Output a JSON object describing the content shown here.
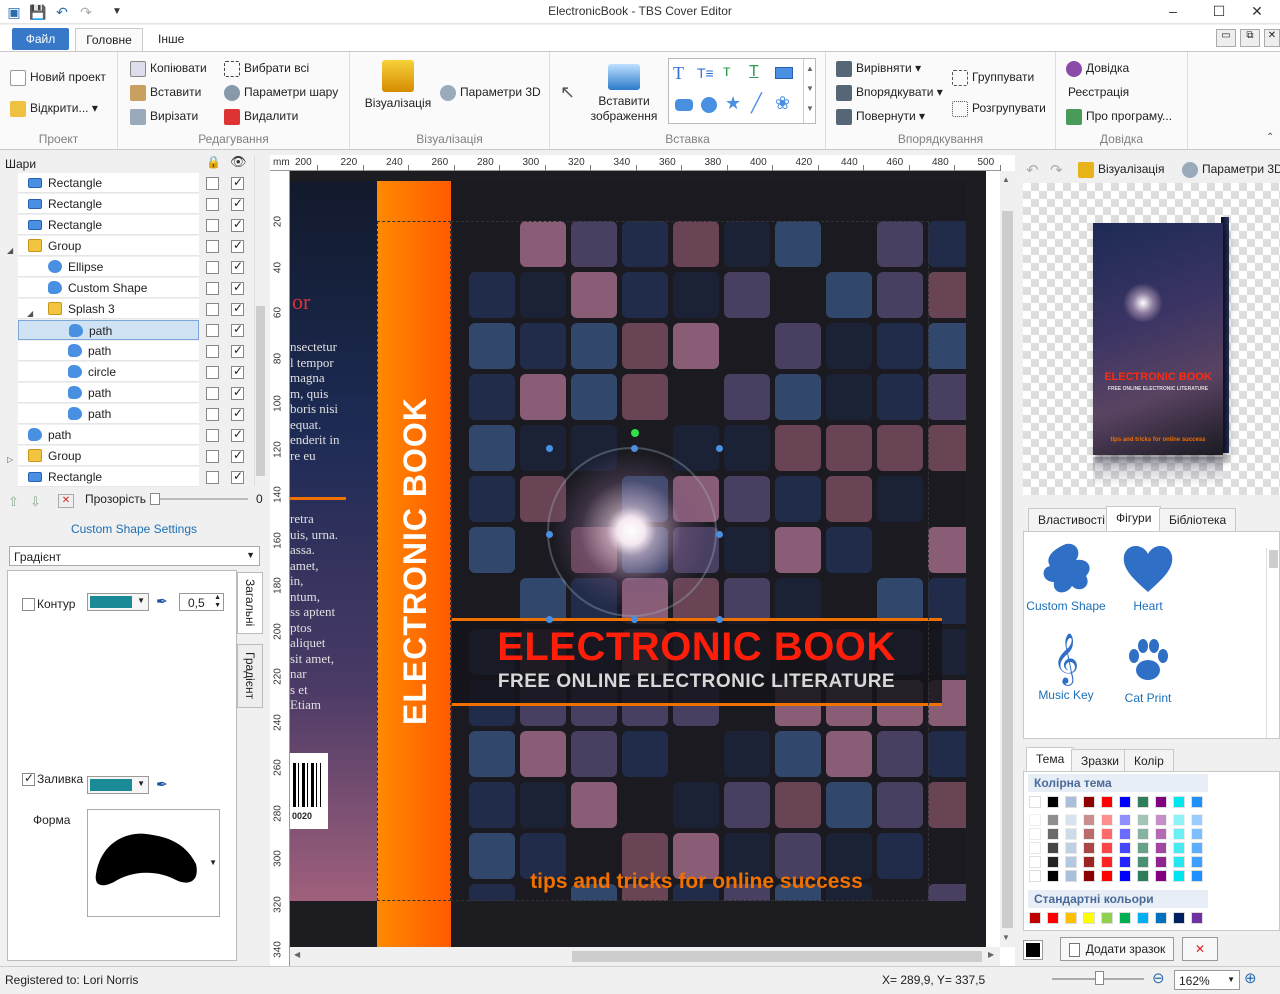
{
  "window": {
    "title": "ElectronicBook - TBS Cover Editor"
  },
  "tabs": {
    "file": "Файл",
    "home": "Головне",
    "other": "Інше"
  },
  "ribbon": {
    "project": {
      "label": "Проект",
      "new": "Новий проект",
      "open": "Відкрити..."
    },
    "edit": {
      "label": "Редагування",
      "copy": "Копіювати",
      "paste": "Вставити",
      "cut": "Вирізати",
      "select_all": "Вибрати всі",
      "layer_params": "Параметри шару",
      "delete": "Видалити"
    },
    "visual": {
      "label": "Візуалізація",
      "visualize": "Візуалізація",
      "params3d": "Параметри 3D"
    },
    "insert": {
      "label": "Вставка",
      "insert_image": "Вставити зображення"
    },
    "arrange": {
      "label": "Впорядкування",
      "align": "Вирівняти",
      "order": "Впорядкувати",
      "rotate": "Повернути",
      "group": "Группувати",
      "ungroup": "Розгрупувати"
    },
    "help": {
      "label": "Довідка",
      "help": "Довідка",
      "register": "Реєстрація",
      "about": "Про програму..."
    }
  },
  "layers": {
    "title": "Шари",
    "items": [
      {
        "name": "Rectangle",
        "icon": "rectangle-icon",
        "indent": 0,
        "checked": true
      },
      {
        "name": "Rectangle",
        "icon": "rectangle-icon",
        "indent": 0,
        "checked": true
      },
      {
        "name": "Rectangle",
        "icon": "rectangle-icon",
        "indent": 0,
        "checked": true
      },
      {
        "name": "Group",
        "icon": "folder-icon",
        "indent": 0,
        "checked": true,
        "expanded": true
      },
      {
        "name": "Ellipse",
        "icon": "ellipse-icon",
        "indent": 1,
        "checked": true
      },
      {
        "name": "Custom Shape",
        "icon": "custom-shape-icon",
        "indent": 1,
        "checked": true
      },
      {
        "name": "Splash 3",
        "icon": "folder-icon",
        "indent": 1,
        "checked": true,
        "expanded": true
      },
      {
        "name": "path",
        "icon": "custom-shape-icon",
        "indent": 2,
        "checked": true,
        "selected": true
      },
      {
        "name": "path",
        "icon": "custom-shape-icon",
        "indent": 2,
        "checked": true
      },
      {
        "name": "circle",
        "icon": "custom-shape-icon",
        "indent": 2,
        "checked": true
      },
      {
        "name": "path",
        "icon": "custom-shape-icon",
        "indent": 2,
        "checked": true
      },
      {
        "name": "path",
        "icon": "custom-shape-icon",
        "indent": 2,
        "checked": true
      },
      {
        "name": "path",
        "icon": "custom-shape-icon",
        "indent": 0,
        "checked": true
      },
      {
        "name": "Group",
        "icon": "folder-icon",
        "indent": 0,
        "checked": true,
        "collapsed": true
      },
      {
        "name": "Rectangle",
        "icon": "rectangle-icon",
        "indent": 0,
        "checked": true
      }
    ],
    "opacity_label": "Прозорість",
    "opacity_value": "0"
  },
  "shape_settings": {
    "title": "Custom Shape Settings",
    "fill_type": "Градієнт",
    "outline_label": "Контур",
    "outline_width": "0,5",
    "fill_label": "Заливка",
    "shape_label": "Форма",
    "tab_general": "Загальні",
    "tab_gradient": "Градієнт",
    "color": "#1a8b96"
  },
  "ruler": {
    "unit": "mm",
    "h_ticks": [
      "200",
      "220",
      "240",
      "260",
      "280",
      "300",
      "320",
      "340",
      "360",
      "380",
      "400",
      "420",
      "440",
      "460",
      "480",
      "500"
    ],
    "v_ticks": [
      "20",
      "40",
      "60",
      "80",
      "100",
      "120",
      "140",
      "160",
      "180",
      "200",
      "220",
      "240",
      "260",
      "280",
      "300",
      "320",
      "340"
    ]
  },
  "cover": {
    "title": "ELECTRONIC BOOK",
    "subtitle": "FREE ONLINE ELECTRONIC LITERATURE",
    "spine": "ELECTRONIC BOOK",
    "tagline": "tips and tricks for online success",
    "back_heading": "or",
    "back_text1": [
      "nsectetur",
      "l tempor",
      "magna",
      "m, quis",
      "boris nisi",
      "equat.",
      "enderit in",
      "re  eu"
    ],
    "back_text2": [
      "retra",
      "uis, urna.",
      "assa.",
      "amet,",
      "in,",
      "ntum,",
      "ss aptent",
      "ptos",
      "aliquet",
      "sit amet,",
      "nar",
      "s  et",
      "Etiam"
    ],
    "barcode_num": "0020"
  },
  "right": {
    "visualize": "Візуалізація",
    "params3d": "Параметри 3D",
    "tab_props": "Властивості",
    "tab_shapes": "Фігури",
    "tab_library": "Бібліотека",
    "shapes": [
      "Custom Shape",
      "Heart",
      "Music Key",
      "Cat Print"
    ],
    "preview_title": "ELECTRONIC BOOK",
    "preview_sub": "FREE ONLINE ELECTRONIC LITERATURE",
    "preview_tag": "tips and tricks for online success",
    "tab_theme": "Тема",
    "tab_samples": "Зразки",
    "tab_color": "Колір",
    "theme_colors": "Колірна тема",
    "standard_colors": "Стандартні кольори",
    "add_sample": "Додати зразок"
  },
  "status": {
    "registered": "Registered to: Lori Norris",
    "coords": "X= 289,9, Y= 337,5",
    "zoom": "162%"
  }
}
